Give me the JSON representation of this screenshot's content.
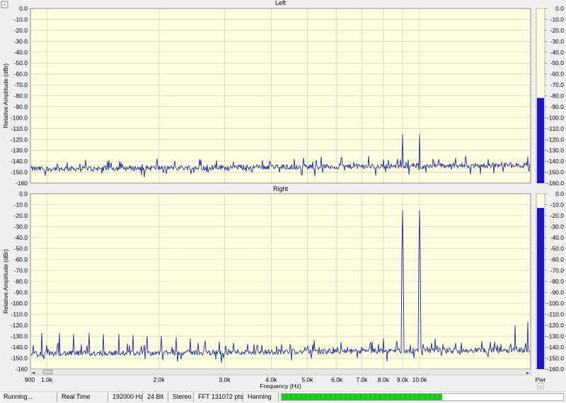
{
  "window": {
    "collapse_glyph": "-"
  },
  "chart_data": [
    {
      "type": "line",
      "title": "Left",
      "xlabel": "Frequency (Hz)",
      "ylabel": "Relative Amplitude (dBr)",
      "x_scale": "log",
      "xlim": [
        900,
        22000
      ],
      "ylim": [
        -160,
        0
      ],
      "x_tick_labels": [
        "900",
        "1.0k",
        "2.0k",
        "3.0k",
        "4.0k",
        "5.0k",
        "6.0k",
        "7.0k",
        "8.0k",
        "9.0k",
        "10.0k"
      ],
      "x_tick_values": [
        900,
        1000,
        2000,
        3000,
        4000,
        5000,
        6000,
        7000,
        8000,
        9000,
        10000
      ],
      "y_tick_labels": [
        "0.0",
        "-10.0",
        "-20.0",
        "-30.0",
        "-40.0",
        "-50.0",
        "-60.0",
        "-70.0",
        "-80.0",
        "-90.0",
        "-100.0",
        "-110.0",
        "-120.0",
        "-130.0",
        "-140.0",
        "-150.0",
        "-160"
      ],
      "grid": true,
      "noise_floor_db": -147,
      "series": [
        {
          "color": "#1f2d9c",
          "peaks": [
            {
              "x": 9000,
              "y": -115
            },
            {
              "x": 10000,
              "y": -115
            }
          ]
        }
      ]
    },
    {
      "type": "line",
      "title": "Right",
      "xlabel": "Frequency (Hz)",
      "ylabel": "Relative Amplitude (dBr)",
      "x_scale": "log",
      "xlim": [
        900,
        22000
      ],
      "ylim": [
        -160,
        0
      ],
      "x_tick_labels": [
        "900",
        "1.0k",
        "2.0k",
        "3.0k",
        "4.0k",
        "5.0k",
        "6.0k",
        "7.0k",
        "8.0k",
        "9.0k",
        "10.0k"
      ],
      "x_tick_values": [
        900,
        1000,
        2000,
        3000,
        4000,
        5000,
        6000,
        7000,
        8000,
        9000,
        10000
      ],
      "y_tick_labels": [
        "0.0",
        "-10.0",
        "-20.0",
        "-30.0",
        "-40.0",
        "-50.0",
        "-60.0",
        "-70.0",
        "-80.0",
        "-90.0",
        "-100.0",
        "-110.0",
        "-120.0",
        "-130.0",
        "-140.0",
        "-150.0",
        "-160"
      ],
      "grid": true,
      "noise_floor_db": -146,
      "series": [
        {
          "color": "#1f2d9c",
          "peaks": [
            {
              "x": 920,
              "y": -138
            },
            {
              "x": 970,
              "y": -127
            },
            {
              "x": 1000,
              "y": -138
            },
            {
              "x": 1080,
              "y": -127
            },
            {
              "x": 1180,
              "y": -128
            },
            {
              "x": 1300,
              "y": -127
            },
            {
              "x": 1420,
              "y": -128
            },
            {
              "x": 1560,
              "y": -128
            },
            {
              "x": 1700,
              "y": -129
            },
            {
              "x": 1860,
              "y": -130
            },
            {
              "x": 2030,
              "y": -130
            },
            {
              "x": 2220,
              "y": -131
            },
            {
              "x": 2430,
              "y": -132
            },
            {
              "x": 2660,
              "y": -134
            },
            {
              "x": 2900,
              "y": -135
            },
            {
              "x": 3170,
              "y": -136
            },
            {
              "x": 3460,
              "y": -137
            },
            {
              "x": 3780,
              "y": -138
            },
            {
              "x": 4130,
              "y": -139
            },
            {
              "x": 4510,
              "y": -139
            },
            {
              "x": 4920,
              "y": -140
            },
            {
              "x": 5370,
              "y": -140
            },
            {
              "x": 5860,
              "y": -140
            },
            {
              "x": 6400,
              "y": -140
            },
            {
              "x": 7000,
              "y": -140
            },
            {
              "x": 8000,
              "y": -132
            },
            {
              "x": 9000,
              "y": -15
            },
            {
              "x": 10000,
              "y": -15
            },
            {
              "x": 10000,
              "y": -51
            },
            {
              "x": 11000,
              "y": -132
            },
            {
              "x": 18000,
              "y": -120
            },
            {
              "x": 19500,
              "y": -117
            }
          ]
        }
      ]
    }
  ],
  "meters": {
    "left_level_db": -82,
    "right_level_db": -13,
    "tick_labels": [
      "0.0",
      "-10.0",
      "-20.0",
      "-30.0",
      "-40.0",
      "-50.0",
      "-60.0",
      "-70.0",
      "-80.0",
      "-90.0",
      "-100.0",
      "-110.0",
      "-120.0",
      "-130.0",
      "-140.0",
      "-150.0",
      "-160.0"
    ],
    "caption": "Pwr",
    "collapse_glyph": "-"
  },
  "scrollbar": {
    "left_arrow": "◄",
    "right_arrow": "►"
  },
  "status": {
    "state": "Running...",
    "mode": "Real Time",
    "sample_rate": "192000 Hz",
    "bit_depth": "24 Bit",
    "channels": "Stereo",
    "fft": "FFT 131072 pts",
    "window": "Hanning",
    "progress_fraction": 0.57
  }
}
